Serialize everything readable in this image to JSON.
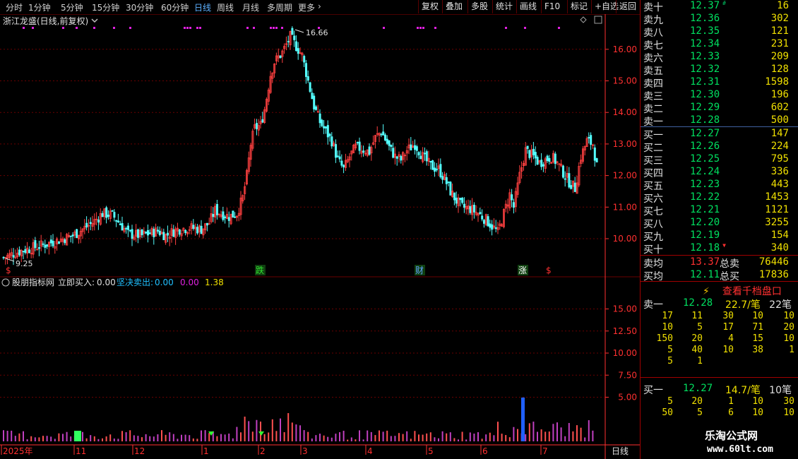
{
  "toolbar": {
    "periods": [
      "分时",
      "1分钟",
      "5分钟",
      "15分钟",
      "30分钟",
      "60分钟",
      "日线",
      "周线",
      "月线",
      "多周期",
      "更多"
    ],
    "active": "日线",
    "more_arrow": "›",
    "right": [
      "复权",
      "叠加",
      "多股",
      "统计",
      "画线",
      "F10",
      "标记",
      "+自选",
      "返回"
    ]
  },
  "chart": {
    "title": "浙江龙盛(日线,前复权)",
    "high_label": "16.66",
    "low_label": "9.25",
    "price_ticks": [
      "16.00",
      "15.00",
      "14.00",
      "13.00",
      "12.00",
      "11.00",
      "10.00"
    ],
    "event_markers": [
      {
        "text": "$",
        "color": "#ff3030"
      },
      {
        "text": "跌",
        "color": "#30e030"
      },
      {
        "text": "财",
        "color": "#60a0ff"
      },
      {
        "text": "涨",
        "color": "#ffffff"
      },
      {
        "text": "$",
        "color": "#ff3030"
      }
    ],
    "indicator": {
      "name": "股朋指标网",
      "buy_label": "立即买入:",
      "buy_value": "0.00",
      "sell_label": "坚决卖出:",
      "sell_value": "0.00",
      "v3": "0.00",
      "v4": "1.38"
    },
    "ind_ticks": [
      "15.00",
      "12.50",
      "10.00",
      "7.50",
      "5.00"
    ],
    "dates": [
      "2025年",
      "11",
      "12",
      "1",
      "2",
      "3",
      "4",
      "5",
      "6",
      "7"
    ],
    "period_label": "日线",
    "colors": {
      "up": "#ff4040",
      "down": "#54ffff",
      "grid": "#6a0000",
      "axis": "#ff3030",
      "magenta": "#e020e0"
    }
  },
  "chart_data": {
    "type": "candlestick",
    "title": "浙江龙盛(日线,前复权)",
    "ylim": [
      9.5,
      16.9
    ],
    "y_ticks": [
      10,
      11,
      12,
      13,
      14,
      15,
      16
    ],
    "x_labels": [
      "2025年",
      "11",
      "12",
      "1",
      "2",
      "3",
      "4",
      "5",
      "6",
      "7"
    ],
    "annotations": {
      "high": 16.66,
      "low": 9.25
    },
    "close_path": [
      [
        0,
        9.4
      ],
      [
        8,
        9.6
      ],
      [
        20,
        9.8
      ],
      [
        35,
        10.1
      ],
      [
        45,
        10.5
      ],
      [
        50,
        10.8
      ],
      [
        55,
        10.75
      ],
      [
        60,
        10.4
      ],
      [
        63,
        10.15
      ],
      [
        70,
        10.1
      ],
      [
        78,
        10.25
      ],
      [
        82,
        10.1
      ],
      [
        88,
        10.3
      ],
      [
        94,
        10.35
      ],
      [
        100,
        10.3
      ],
      [
        104,
        10.5
      ],
      [
        107,
        10.9
      ],
      [
        110,
        10.8
      ],
      [
        114,
        10.7
      ],
      [
        118,
        10.8
      ],
      [
        121,
        11.3
      ],
      [
        123,
        12.0
      ],
      [
        125,
        13.0
      ],
      [
        127,
        13.5
      ],
      [
        130,
        13.6
      ],
      [
        132,
        14.1
      ],
      [
        135,
        15.2
      ],
      [
        137,
        15.6
      ],
      [
        141,
        15.9
      ],
      [
        145,
        16.4
      ],
      [
        148,
        16.1
      ],
      [
        151,
        15.8
      ],
      [
        154,
        15.0
      ],
      [
        157,
        14.2
      ],
      [
        160,
        13.7
      ],
      [
        163,
        13.4
      ],
      [
        166,
        13.1
      ],
      [
        169,
        12.5
      ],
      [
        172,
        12.2
      ],
      [
        175,
        12.6
      ],
      [
        178,
        12.9
      ],
      [
        181,
        12.85
      ],
      [
        185,
        12.75
      ],
      [
        188,
        13.2
      ],
      [
        191,
        13.4
      ],
      [
        195,
        12.9
      ],
      [
        198,
        12.6
      ],
      [
        201,
        12.5
      ],
      [
        204,
        12.8
      ],
      [
        208,
        13.0
      ],
      [
        212,
        12.6
      ],
      [
        216,
        12.3
      ],
      [
        220,
        12.2
      ],
      [
        223,
        11.9
      ],
      [
        226,
        11.5
      ],
      [
        229,
        11.2
      ],
      [
        232,
        11.0
      ],
      [
        236,
        10.95
      ],
      [
        240,
        10.8
      ],
      [
        244,
        10.6
      ],
      [
        247,
        10.4
      ],
      [
        250,
        10.2
      ],
      [
        253,
        10.8
      ],
      [
        256,
        11.4
      ],
      [
        258,
        11.0
      ],
      [
        261,
        12.0
      ],
      [
        264,
        12.8
      ],
      [
        268,
        12.6
      ],
      [
        271,
        12.4
      ],
      [
        274,
        12.5
      ],
      [
        277,
        12.6
      ],
      [
        280,
        12.4
      ],
      [
        283,
        12.1
      ],
      [
        286,
        11.8
      ],
      [
        289,
        11.6
      ],
      [
        292,
        12.6
      ],
      [
        295,
        13.1
      ],
      [
        298,
        13.0
      ],
      [
        300,
        12.3
      ]
    ],
    "indicator_series": [
      {
        "name": "立即买入",
        "value": 0.0
      },
      {
        "name": "坚决卖出",
        "value": 0.0
      }
    ],
    "ind_ylim": [
      0,
      17.5
    ],
    "ind_y_ticks": [
      5.0,
      7.5,
      10.0,
      12.5,
      15.0
    ]
  },
  "book": {
    "sell": [
      {
        "name": "卖十",
        "price": "12.37",
        "vol": "16",
        "mark": "#"
      },
      {
        "name": "卖九",
        "price": "12.36",
        "vol": "302"
      },
      {
        "name": "卖八",
        "price": "12.35",
        "vol": "121"
      },
      {
        "name": "卖七",
        "price": "12.34",
        "vol": "231"
      },
      {
        "name": "卖六",
        "price": "12.33",
        "vol": "209"
      },
      {
        "name": "卖五",
        "price": "12.32",
        "vol": "128"
      },
      {
        "name": "卖四",
        "price": "12.31",
        "vol": "1598"
      },
      {
        "name": "卖三",
        "price": "12.30",
        "vol": "196"
      },
      {
        "name": "卖二",
        "price": "12.29",
        "vol": "602"
      },
      {
        "name": "卖一",
        "price": "12.28",
        "vol": "500"
      }
    ],
    "buy": [
      {
        "name": "买一",
        "price": "12.27",
        "vol": "147"
      },
      {
        "name": "买二",
        "price": "12.26",
        "vol": "224"
      },
      {
        "name": "买三",
        "price": "12.25",
        "vol": "795"
      },
      {
        "name": "买四",
        "price": "12.24",
        "vol": "336"
      },
      {
        "name": "买五",
        "price": "12.23",
        "vol": "443"
      },
      {
        "name": "买六",
        "price": "12.22",
        "vol": "1453"
      },
      {
        "name": "买七",
        "price": "12.21",
        "vol": "1121"
      },
      {
        "name": "买八",
        "price": "12.20",
        "vol": "3255"
      },
      {
        "name": "买九",
        "price": "12.19",
        "vol": "154"
      },
      {
        "name": "买十",
        "price": "12.18",
        "vol": "340",
        "mark": "▼"
      }
    ],
    "avg": [
      {
        "name": "卖均",
        "price": "13.37",
        "tname": "总卖",
        "tvol": "76446",
        "pcolor": "#ff3030"
      },
      {
        "name": "买均",
        "price": "12.11",
        "tname": "总买",
        "tvol": "17836",
        "pcolor": "#00e060"
      }
    ],
    "view_button": "查看千档盘口",
    "q_sell": {
      "label": "卖一",
      "price": "12.28",
      "per": "22.7/笔",
      "count": "22笔",
      "rows": [
        [
          "17",
          "11",
          "30",
          "10",
          "10"
        ],
        [
          "10",
          "5",
          "17",
          "71",
          "20"
        ],
        [
          "150",
          "20",
          "4",
          "15",
          "10"
        ],
        [
          "5",
          "40",
          "10",
          "38",
          "1"
        ],
        [
          "5",
          "1",
          "",
          "",
          ""
        ]
      ]
    },
    "q_buy": {
      "label": "买一",
      "price": "12.27",
      "per": "14.7/笔",
      "count": "10笔",
      "rows": [
        [
          "5",
          "20",
          "1",
          "10",
          "30"
        ],
        [
          "50",
          "5",
          "6",
          "10",
          "10"
        ]
      ]
    }
  },
  "watermark": {
    "line1": "乐淘公式网",
    "line2": "www.60lt.com"
  }
}
